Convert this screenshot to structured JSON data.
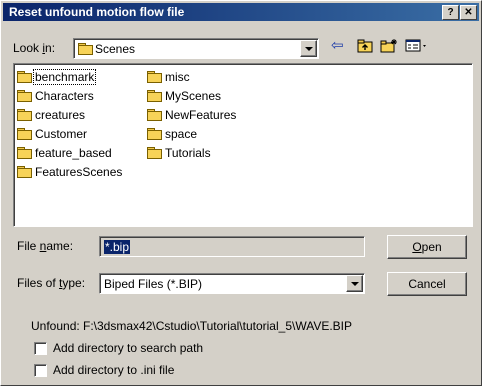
{
  "window": {
    "title": "Reset unfound motion flow file",
    "help_btn": "?",
    "close_btn": "✕"
  },
  "look_in": {
    "label_pre": "Look ",
    "label_u": "i",
    "label_post": "n:",
    "value": "Scenes"
  },
  "toolbar": {
    "back_icon": "⇦",
    "up_icon": "up-folder",
    "new_icon": "new-folder",
    "view_icon": "view-menu"
  },
  "files": {
    "left": [
      "benchmark",
      "Characters",
      "creatures",
      "Customer",
      "feature_based",
      "FeaturesScenes"
    ],
    "right": [
      "misc",
      "MyScenes",
      "NewFeatures",
      "space",
      "Tutorials"
    ]
  },
  "file_name": {
    "label_pre": "File ",
    "label_u": "n",
    "label_post": "ame:",
    "value": "*.bip"
  },
  "file_type": {
    "label_pre": "Files of ",
    "label_u": "t",
    "label_post": "ype:",
    "value": "Biped Files (*.BIP)"
  },
  "buttons": {
    "open_u": "O",
    "open_rest": "pen",
    "cancel": "Cancel"
  },
  "unfound": {
    "label": "Unfound:",
    "path": "F:\\3dsmax42\\Cstudio\\Tutorial\\tutorial_5\\WAVE.BIP"
  },
  "options": {
    "add_search_path": "Add directory to search path",
    "add_ini": "Add directory to .ini file"
  }
}
